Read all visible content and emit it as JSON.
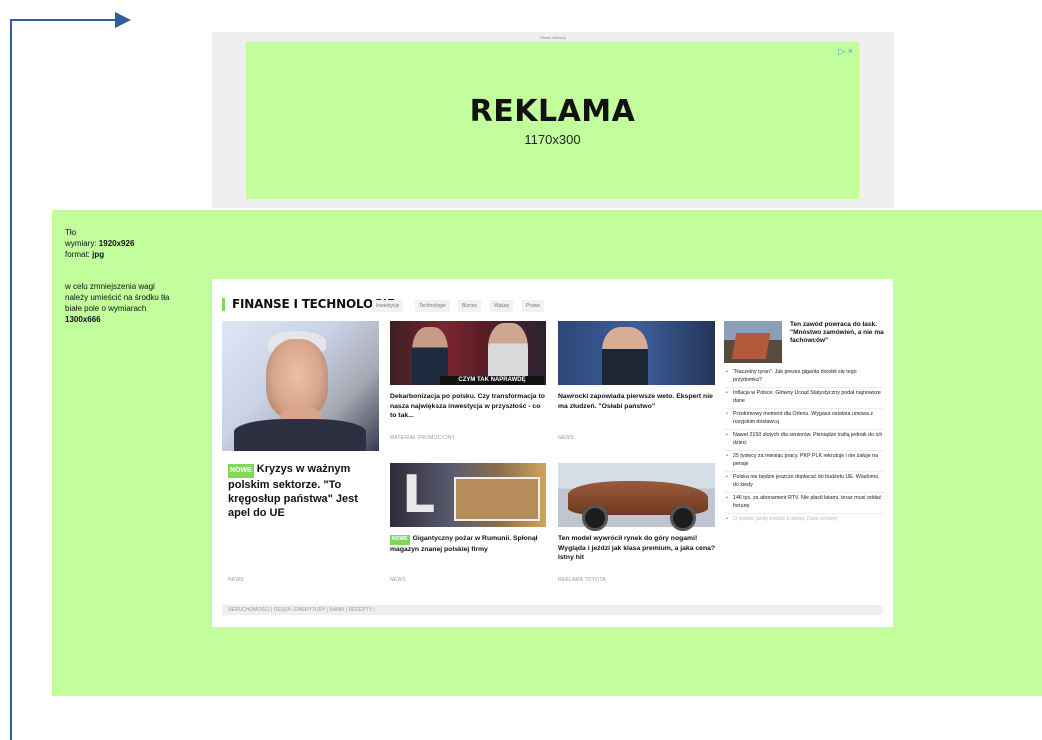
{
  "banner": {
    "frame_caption": "Strefa reklamy",
    "title": "REKLAMA",
    "size": "1170x300",
    "badge": "▷ ×"
  },
  "notes": {
    "bg_title": "Tło",
    "dims_label": "wymiary:",
    "dims_value": "1920x926",
    "format_label": "format:",
    "format_value": "jpg",
    "instr_1": "w celu zmniejszenia wagi",
    "instr_2": "należy umieścić na środku tła",
    "instr_3": "białe pole o wymiarach",
    "instr_value": "1300x666"
  },
  "section": {
    "title": "FINANSE I TECHNOLOGIE",
    "tabs": [
      "Inwestycje",
      "Technologie",
      "Biznes",
      "Waluty",
      "Prawo"
    ]
  },
  "main_article": {
    "badge": "NOWE",
    "headline": "Kryzys w ważnym polskim sektorze. \"To kręgosłup państwa\" Jest apel do UE",
    "source": "NEWS"
  },
  "articles": [
    {
      "image_caption": "CZYM TAK NAPRAWDĘ",
      "headline": "Dekarbonizacja po polsku. Czy transformacja to nasza największa inwestycja w przyszłość - co to tak...",
      "source": "MATERIAŁ PROMOCYJNY"
    },
    {
      "headline": "Nawrocki zapowiada pierwsze weto. Ekspert nie ma złudzeń. \"Osłabi państwo\"",
      "source": "NEWS"
    },
    {
      "badge": "NOWE",
      "headline": "Gigantyczny pożar w Rumunii. Spłonął magazyn znanej polskiej firmy",
      "source": "NEWS"
    },
    {
      "headline": "Ten model wywrócił rynek do góry nogami! Wygląda i jeździ jak klasa premium, a jaka cena? Istny hit",
      "source": "REKLAMA TOYOTA"
    }
  ],
  "sidebar": {
    "lead": "Ten zawód powraca do łask. \"Mnóstwo zamówień, a nie ma fachowców\"",
    "items": [
      "\"Naczelny tyran\". Jak prezes giganta dorobił się tego przydomka?",
      "Inflacja w Polsce. Główny Urząd Statystyczny podał najnowsze dane",
      "Przełomowy moment dla Orlenu. Wygasa ostatnia umowa z rosyjskim dostawcą",
      "Nawet 2150 złotych dla seniorów. Pieniądze trafią jednak do ich dzieci",
      "25 tysięcy za miesiąc pracy. PKP PLK rekrutuje i nie żałuje na pensje",
      "Polska nie będzie jeszcze dopłacać do budżetu UE. Wiadomo, do kiedy",
      "146 tys. za abonament RTV. Nie płacił latami, teraz musi oddać fortunę",
      "O prawie jazdy będzie trudniej. Dwie zmiany"
    ]
  },
  "footer": {
    "links": "NERUCHOMOŚCI  |  DESZA  |  EMERYTURY  |  BANKI  |  RECEPTY  |"
  }
}
